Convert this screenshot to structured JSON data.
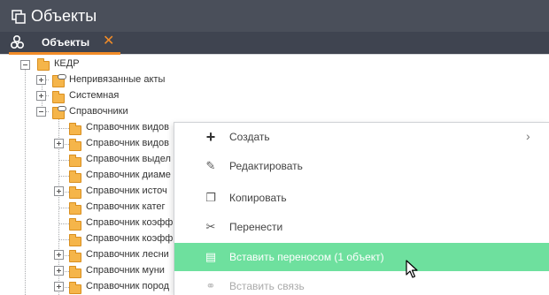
{
  "window": {
    "title": "Объекты",
    "icon": "copy-windows-icon"
  },
  "tabs": [
    {
      "label": "Объекты",
      "icon": "cubes-icon",
      "close_icon": "close-icon",
      "accent": "#f28c28"
    }
  ],
  "tree": {
    "root": {
      "label": "КЕДР",
      "expanded": true
    },
    "children": [
      {
        "label": "Непривязанные акты",
        "expanded": false
      },
      {
        "label": "Системная",
        "expanded": false
      },
      {
        "label": "Справочники",
        "expanded": true
      }
    ],
    "reference_items": [
      {
        "label": "Справочник видов",
        "has_children": false
      },
      {
        "label": "Справочник видов",
        "has_children": true
      },
      {
        "label": "Справочник выдел",
        "has_children": false
      },
      {
        "label": "Справочник диаме",
        "has_children": false
      },
      {
        "label": "Справочник источ",
        "has_children": true
      },
      {
        "label": "Справочник катег",
        "has_children": false
      },
      {
        "label": "Справочник коэфф",
        "has_children": false
      },
      {
        "label": "Справочник коэфф",
        "has_children": false
      },
      {
        "label": "Справочник лесни",
        "has_children": true
      },
      {
        "label": "Справочник муни",
        "has_children": true
      },
      {
        "label": "Справочник пород",
        "has_children": true
      }
    ]
  },
  "context_menu": {
    "items": [
      {
        "label": "Создать",
        "icon": "plus-icon",
        "submenu": true,
        "state": "normal"
      },
      {
        "label": "Редактировать",
        "icon": "edit-icon",
        "submenu": false,
        "state": "normal"
      },
      {
        "label": "Копировать",
        "icon": "copy-icon",
        "submenu": false,
        "state": "normal"
      },
      {
        "label": "Перенести",
        "icon": "scissors-icon",
        "submenu": false,
        "state": "normal"
      },
      {
        "label": "Вставить переносом (1 объект)",
        "icon": "paste-icon",
        "submenu": false,
        "state": "highlighted"
      },
      {
        "label": "Вставить связь",
        "icon": "link-icon",
        "submenu": false,
        "state": "disabled"
      }
    ],
    "highlight_color": "#6ee09e"
  },
  "colors": {
    "titlebar": "#4a4f5a",
    "tabbar": "#3f4450",
    "accent": "#f28c28",
    "folder": "#f5b54a"
  }
}
